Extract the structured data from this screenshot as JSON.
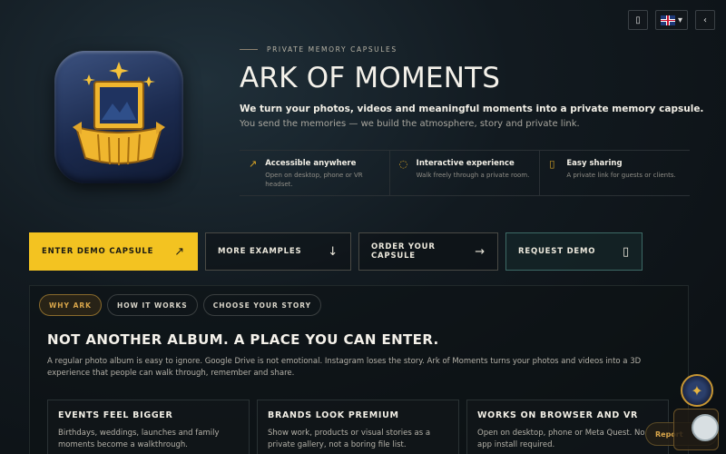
{
  "topbar": {
    "phone_icon": "phone-icon",
    "language_flag": "uk-flag-icon",
    "language_caret": "▾",
    "back_icon": "‹"
  },
  "hero": {
    "eyebrow": "PRIVATE MEMORY CAPSULES",
    "title": "ARK OF MOMENTS",
    "lead": "We turn your photos, videos and meaningful moments into a private memory capsule.",
    "sub": "You send the memories — we build the atmosphere, story and private link."
  },
  "features": [
    {
      "icon": "↗",
      "title": "Accessible anywhere",
      "text": "Open on desktop, phone or VR headset."
    },
    {
      "icon": "◌",
      "title": "Interactive experience",
      "text": "Walk freely through a private room."
    },
    {
      "icon": "▯",
      "title": "Easy sharing",
      "text": "A private link for guests or clients."
    }
  ],
  "cta": {
    "enter": {
      "label": "ENTER DEMO CAPSULE",
      "icon": "↗"
    },
    "examples": {
      "label": "MORE EXAMPLES",
      "icon": "↓"
    },
    "order": {
      "label": "ORDER YOUR CAPSULE",
      "icon": "→"
    },
    "request": {
      "label": "REQUEST DEMO",
      "icon": "▯"
    }
  },
  "tabs": [
    "WHY ARK",
    "HOW IT WORKS",
    "CHOOSE YOUR STORY"
  ],
  "section": {
    "heading": "NOT ANOTHER ALBUM. A PLACE YOU CAN ENTER.",
    "description": "A regular photo album is easy to ignore. Google Drive is not emotional. Instagram loses the story. Ark of Moments turns your photos and videos into a 3D experience that people can walk through, remember and share."
  },
  "cards": [
    {
      "title": "EVENTS FEEL BIGGER",
      "text": "Birthdays, weddings, launches and family moments become a walkthrough."
    },
    {
      "title": "BRANDS LOOK PREMIUM",
      "text": "Show work, products or visual stories as a private gallery, not a boring file list."
    },
    {
      "title": "WORKS ON BROWSER AND VR",
      "text": "Open on desktop, phone or Meta Quest. No app install required."
    }
  ],
  "floating": {
    "pill_label": "Report"
  },
  "colors": {
    "accent": "#f3c321",
    "gold": "#d9a64a",
    "teal": "#3d6a66",
    "background": "#0b0f12"
  }
}
